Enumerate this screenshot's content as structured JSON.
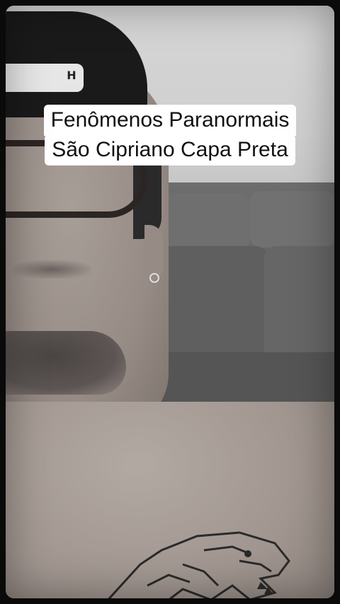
{
  "caption": {
    "line1": "Fenômenos Paranormais",
    "line2": "São Cipriano Capa Preta",
    "background_color": "#ffffff",
    "text_color": "#111111"
  },
  "scene": {
    "cap_logo_icon": "hurley-h-logo-icon",
    "tattoo_icon": "wolf-head-tattoo-icon"
  }
}
